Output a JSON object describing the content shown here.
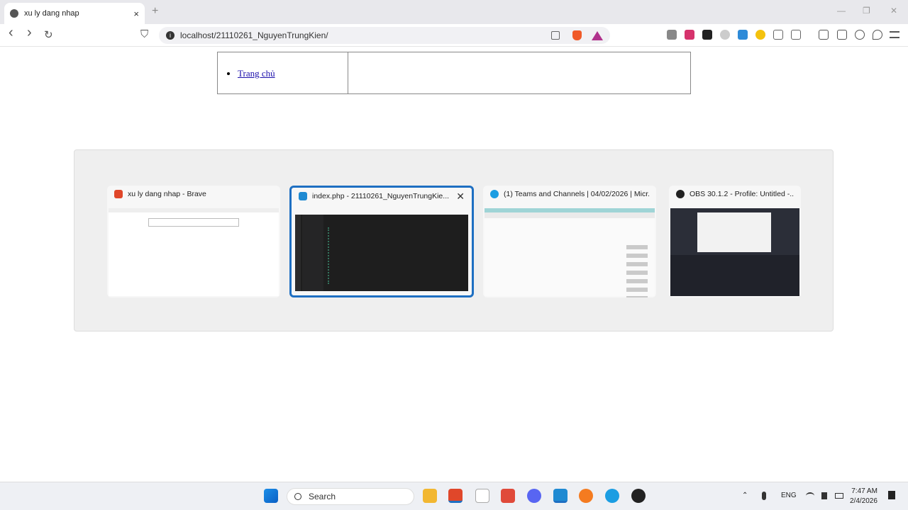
{
  "browser": {
    "tab_title": "xu ly dang nhap",
    "tab_close": "×",
    "new_tab": "+",
    "url": "localhost/21110261_NguyenTrungKien/",
    "info_glyph": "i",
    "back": "‹",
    "forward": "›",
    "reload": "↻",
    "bookmark": "⛉",
    "window_controls": [
      "—",
      "❐",
      "✕"
    ]
  },
  "page": {
    "menu_items": [
      "Trang chủ"
    ]
  },
  "switcher": {
    "windows": [
      {
        "title": "xu ly dang nhap - Brave",
        "icon": "brave-icon",
        "color": "#e0472a"
      },
      {
        "title": "index.php - 21110261_NguyenTrungKie...",
        "icon": "vscode-icon",
        "color": "#1f8ad2",
        "close": "✕"
      },
      {
        "title": "(1) Teams and Channels | 04/02/2026 | Micr...",
        "icon": "edge-icon",
        "color": "#1b9de2"
      },
      {
        "title": "OBS 30.1.2 - Profile: Untitled -...",
        "icon": "obs-icon",
        "color": "#222222"
      }
    ]
  },
  "taskbar": {
    "search_label": "Search",
    "language": "ENG",
    "time": "7:47 AM",
    "date": "2/4/2026"
  }
}
